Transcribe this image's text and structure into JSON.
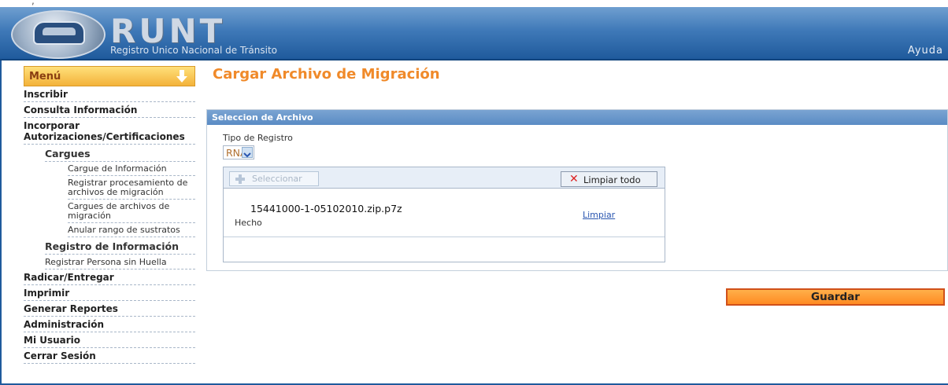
{
  "top_strip": {
    "text": ", "
  },
  "header": {
    "logo_text": "RUNT",
    "subtitle": "Registro Unico Nacional de Tránsito",
    "help": "Ayuda"
  },
  "sidebar": {
    "menu_label": "Menú",
    "items": [
      {
        "label": "Inscribir",
        "level": 0
      },
      {
        "label": "Consulta Información",
        "level": 0
      },
      {
        "label": "Incorporar Autorizaciones/Certificaciones",
        "level": 0
      },
      {
        "label": "Cargues",
        "level": 1
      },
      {
        "label": "Cargue de Información",
        "level": 2
      },
      {
        "label": "Registrar procesamiento de archivos de migración",
        "level": 2
      },
      {
        "label": "Cargues de archivos de migración",
        "level": 2
      },
      {
        "label": "Anular rango de sustratos",
        "level": 2
      },
      {
        "label": "Registro de Información",
        "level": 1
      },
      {
        "label": "Registrar Persona sin Huella",
        "level": 1
      },
      {
        "label": "Radicar/Entregar",
        "level": 0
      },
      {
        "label": "Imprimir",
        "level": 0
      },
      {
        "label": "Generar Reportes",
        "level": 0
      },
      {
        "label": "Administración",
        "level": 0
      },
      {
        "label": "Mi Usuario",
        "level": 0
      },
      {
        "label": "Cerrar Sesión",
        "level": 0
      }
    ]
  },
  "main": {
    "title": "Cargar Archivo de Migración",
    "panel_title": "Seleccion de Archivo",
    "tipo_label": "Tipo de Registro",
    "tipo_value": "RNA",
    "uploader": {
      "select_label": "Seleccionar",
      "clear_all_label": "Limpiar todo",
      "file_name": "15441000-1-05102010.zip.p7z",
      "file_status": "Hecho",
      "file_clear_label": "Limpiar"
    },
    "save_label": "Guardar"
  },
  "colors": {
    "header_blue": "#1f5a9c",
    "title_orange": "#f08a2a",
    "save_orange": "#ff8a22",
    "link_blue": "#2a56b0"
  }
}
